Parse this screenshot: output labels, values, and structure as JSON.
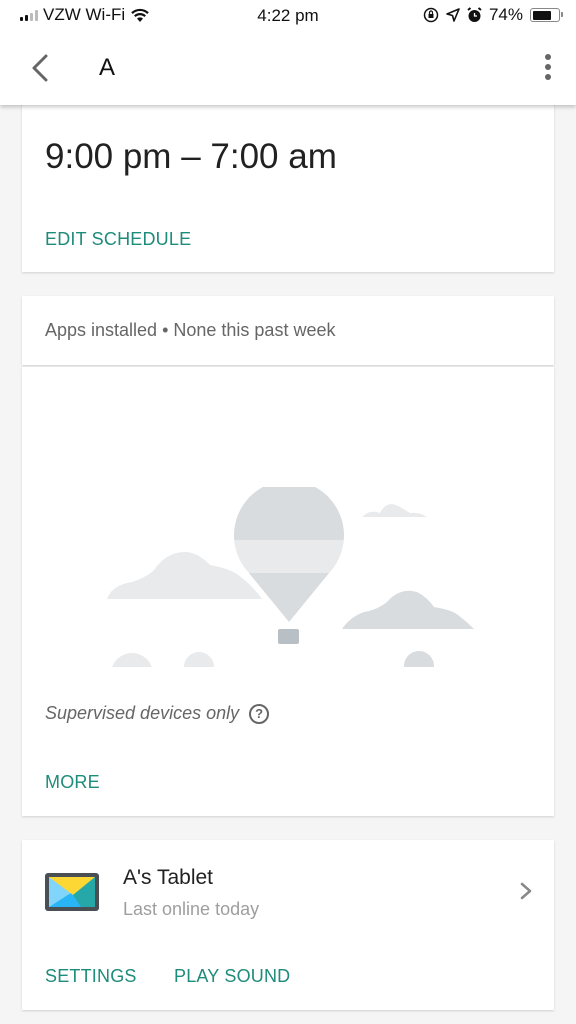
{
  "status_bar": {
    "carrier": "VZW Wi-Fi",
    "time": "4:22 pm",
    "battery_percent": "74%",
    "battery_level": 0.74,
    "icons": [
      "signal-icon",
      "wifi-icon",
      "orientation-lock-icon",
      "location-icon",
      "alarm-icon",
      "battery-icon"
    ]
  },
  "app_bar": {
    "title": "A",
    "back_icon": "chevron-left-icon",
    "menu_icon": "more-vert-icon"
  },
  "schedule_card": {
    "time_range": "9:00 pm – 7:00 am",
    "edit_label": "EDIT SCHEDULE"
  },
  "apps_card": {
    "header": "Apps installed • None this past week",
    "illustration": "hot-air-balloon-illustration",
    "note": "Supervised devices only",
    "help_icon": "help-circle-icon",
    "more_label": "MORE"
  },
  "device_card": {
    "name": "A's Tablet",
    "status": "Last online today",
    "icon": "tablet-icon",
    "actions": [
      {
        "label": "SETTINGS"
      },
      {
        "label": "PLAY SOUND"
      }
    ]
  },
  "colors": {
    "accent": "#1e8c7a",
    "background": "#f5f5f5",
    "card": "#ffffff"
  }
}
